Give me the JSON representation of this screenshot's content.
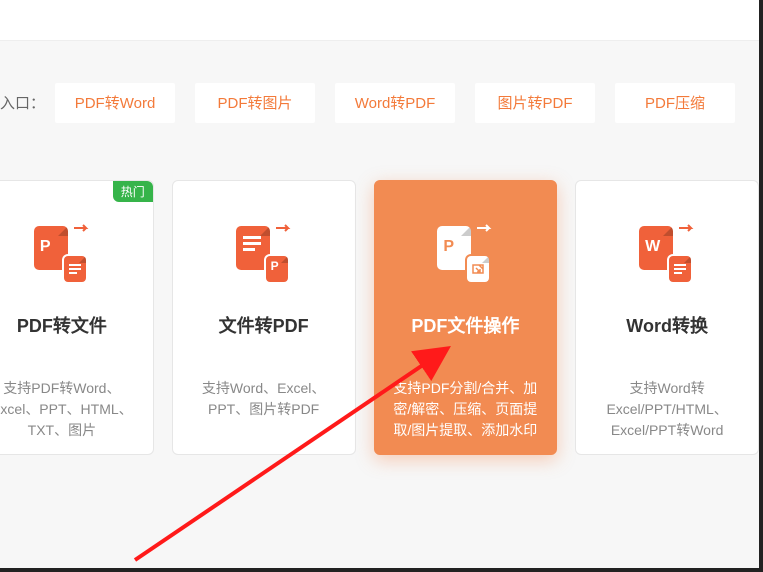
{
  "colors": {
    "accent": "#f37a3a",
    "card_active": "#f28b52",
    "badge": "#36b44a"
  },
  "quick": {
    "label": "入口：",
    "items": [
      {
        "label": "PDF转Word"
      },
      {
        "label": "PDF转图片"
      },
      {
        "label": "Word转PDF"
      },
      {
        "label": "图片转PDF"
      },
      {
        "label": "PDF压缩"
      }
    ]
  },
  "cards": [
    {
      "title": "PDF转文件",
      "desc": "支持PDF转Word、Excel、PPT、HTML、TXT、图片",
      "badge": "热门",
      "active": false,
      "icon": "pdf-to-file"
    },
    {
      "title": "文件转PDF",
      "desc": "支持Word、Excel、PPT、图片转PDF",
      "active": false,
      "icon": "file-to-pdf"
    },
    {
      "title": "PDF文件操作",
      "desc": "支持PDF分割/合并、加密/解密、压缩、页面提取/图片提取、添加水印",
      "active": true,
      "icon": "pdf-ops"
    },
    {
      "title": "Word转换",
      "desc": "支持Word转Excel/PPT/HTML、Excel/PPT转Word",
      "active": false,
      "icon": "word-convert"
    }
  ]
}
